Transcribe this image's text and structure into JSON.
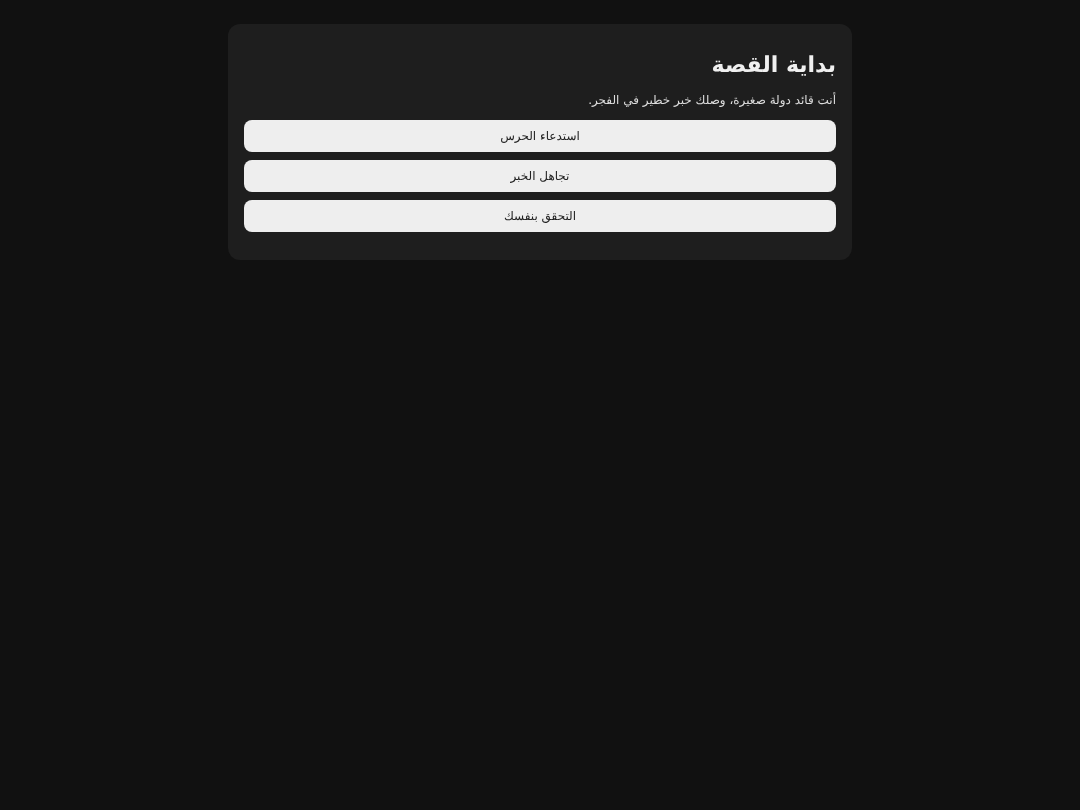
{
  "title": "بداية القصة",
  "text": "أنت قائد دولة صغيرة، وصلك خبر خطير في الفجر.",
  "choices": [
    "استدعاء الحرس",
    "تجاهل الخبر",
    "التحقق بنفسك"
  ]
}
